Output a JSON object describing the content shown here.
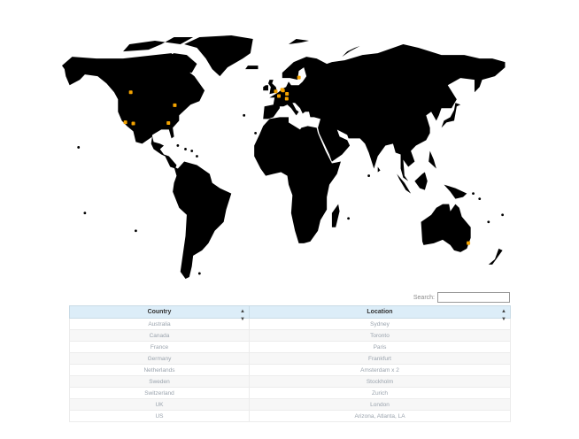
{
  "map": {
    "land_color": "#000000",
    "marker_color": "#f4a300",
    "markers": [
      {
        "name": "Sydney",
        "lat": -33.9,
        "lon": 151.2
      },
      {
        "name": "Toronto",
        "lat": 43.7,
        "lon": -79.4
      },
      {
        "name": "Paris",
        "lat": 48.9,
        "lon": 2.35
      },
      {
        "name": "Frankfurt",
        "lat": 50.1,
        "lon": 8.7
      },
      {
        "name": "Amsterdam",
        "lat": 52.4,
        "lon": 4.9
      },
      {
        "name": "Amsterdam",
        "lat": 52.0,
        "lon": 5.6
      },
      {
        "name": "Stockholm",
        "lat": 59.3,
        "lon": 18.1
      },
      {
        "name": "Zurich",
        "lat": 47.4,
        "lon": 8.5
      },
      {
        "name": "London",
        "lat": 51.5,
        "lon": -0.1
      },
      {
        "name": "Arizona",
        "lat": 33.4,
        "lon": -112.0
      },
      {
        "name": "Atlanta",
        "lat": 33.7,
        "lon": -84.4
      },
      {
        "name": "LA",
        "lat": 34.1,
        "lon": -118.2
      },
      {
        "name": "Calgary",
        "lat": 51.0,
        "lon": -114.0
      }
    ]
  },
  "search": {
    "label": "Search:",
    "value": "",
    "placeholder": ""
  },
  "table": {
    "headers": [
      {
        "label": "Country",
        "sort_icon": "sort-icon"
      },
      {
        "label": "Location",
        "sort_icon": "sort-icon"
      }
    ],
    "rows": [
      [
        "Australia",
        "Sydney"
      ],
      [
        "Canada",
        "Toronto"
      ],
      [
        "France",
        "Paris"
      ],
      [
        "Germany",
        "Frankfurt"
      ],
      [
        "Netherlands",
        "Amsterdam x 2"
      ],
      [
        "Sweden",
        "Stockholm"
      ],
      [
        "Switzerland",
        "Zurich"
      ],
      [
        "UK",
        "London"
      ],
      [
        "US",
        "Arizona, Atlanta, LA"
      ]
    ]
  }
}
